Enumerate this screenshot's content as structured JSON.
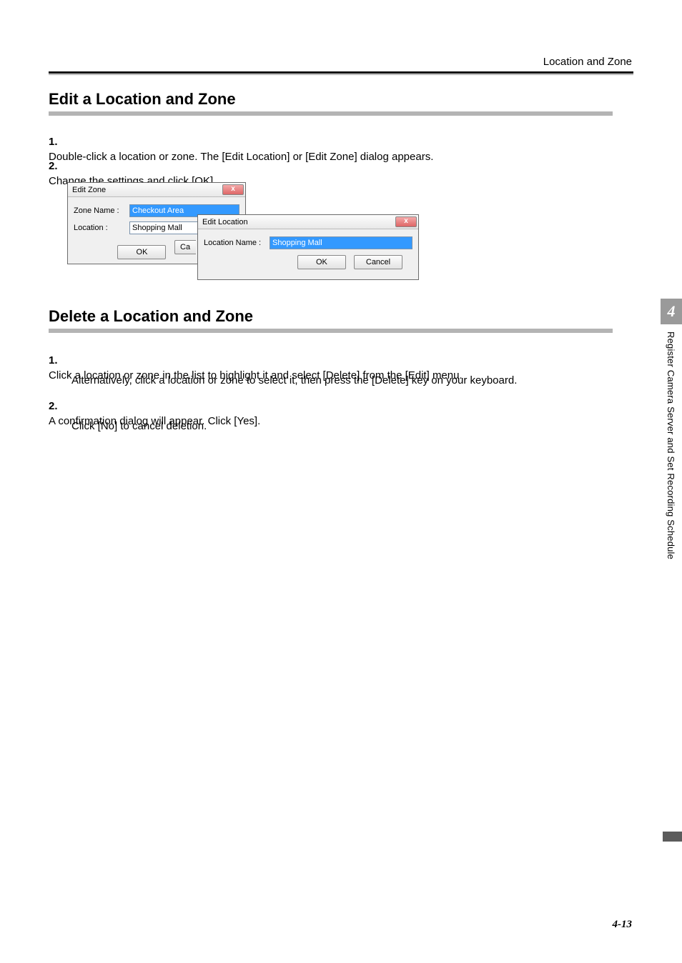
{
  "header": {
    "section_label": "Location and Zone"
  },
  "section_edit": {
    "heading": "Edit a Location and Zone",
    "steps": [
      {
        "num": "1.",
        "text": "Double-click a location or zone. The [Edit Location] or [Edit Zone] dialog appears."
      },
      {
        "num": "2.",
        "text": "Change the settings and click [OK]."
      }
    ]
  },
  "section_delete": {
    "heading": "Delete a Location and Zone",
    "steps": [
      {
        "num": "1.",
        "text": "Click a location or zone in the list to highlight it and select [Delete] from the [Edit] menu.",
        "sub": "Alternatively, click a location or zone to select it, then press the [Delete] key on your keyboard."
      },
      {
        "num": "2.",
        "text": "A confirmation dialog will appear. Click [Yes].",
        "sub": "Click [No] to cancel deletion."
      }
    ]
  },
  "edit_zone_dialog": {
    "title": "Edit Zone",
    "zone_name_label": "Zone Name :",
    "zone_name_value": "Checkout Area",
    "location_label": "Location :",
    "location_value": "Shopping Mall",
    "ok_label": "OK",
    "cancel_label": "Ca"
  },
  "edit_location_dialog": {
    "title": "Edit Location",
    "location_name_label": "Location Name :",
    "location_name_value": "Shopping Mall",
    "ok_label": "OK",
    "cancel_label": "Cancel"
  },
  "side_tab": {
    "number": "4",
    "text": "Register Camera Server and Set Recording Schedule"
  },
  "page_number": "4-13",
  "glyphs": {
    "close_x": "x",
    "dropdown": "▾"
  }
}
